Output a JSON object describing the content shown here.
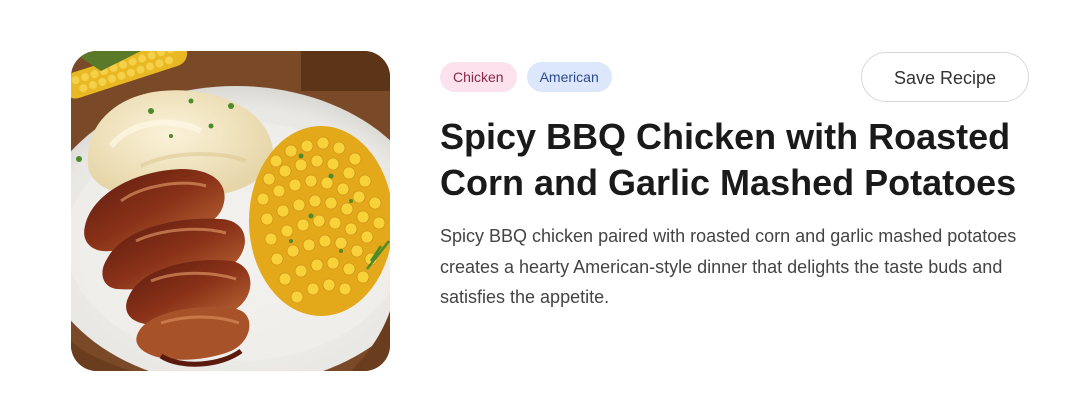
{
  "recipe": {
    "image_alt": "Spicy BBQ chicken with roasted corn and garlic mashed potatoes on a white plate",
    "tags": [
      {
        "label": "Chicken",
        "color": "#fbe2ec",
        "text_color": "#8a2748"
      },
      {
        "label": "American",
        "color": "#dde7fb",
        "text_color": "#2c4a8f"
      }
    ],
    "save_label": "Save Recipe",
    "title": "Spicy BBQ Chicken with Roasted Corn and Garlic Mashed Potatoes",
    "description": "Spicy BBQ chicken paired with roasted corn and garlic mashed potatoes creates a hearty American-style dinner that delights the taste buds and satisfies the appetite."
  }
}
